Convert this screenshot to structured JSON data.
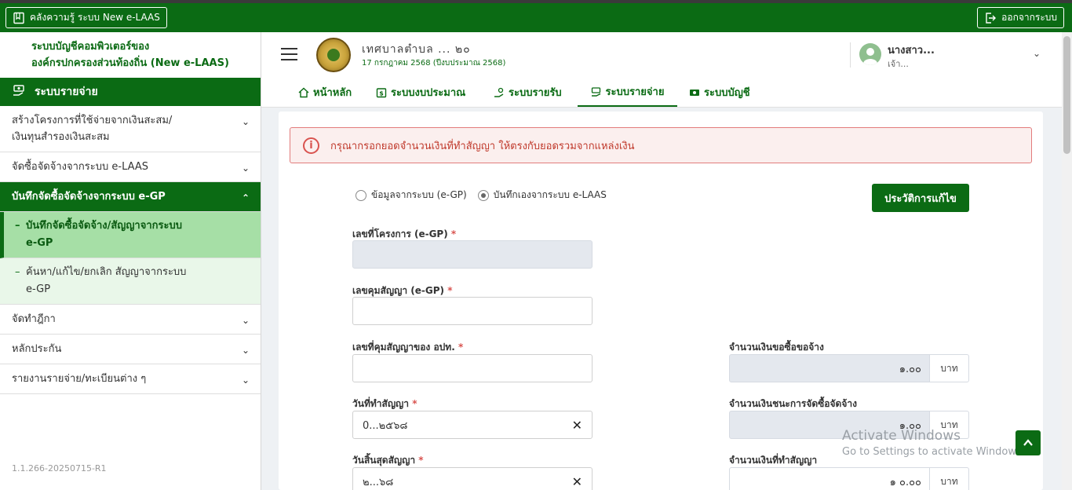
{
  "topbar": {
    "knowledge_label": "คลังความรู้ ระบบ New e-LAAS",
    "logout_label": "ออกจากระบบ"
  },
  "sidebar": {
    "brand_line1": "ระบบบัญชีคอมพิวเตอร์ของ",
    "brand_line2": "องค์กรปกครองส่วนท้องถิ่น (New e-LAAS)",
    "section_title": "ระบบรายจ่าย",
    "items": [
      {
        "label_line1": "สร้างโครงการที่ใช้จ่ายจากเงินสะสม/",
        "label_line2": "เงินทุนสำรองเงินสะสม"
      },
      {
        "label": "จัดซื้อจัดจ้างจากระบบ e-LAAS"
      },
      {
        "label": "บันทึกจัดซื้อจัดจ้างจากระบบ e-GP"
      },
      {
        "label": "จัดทำฎีกา"
      },
      {
        "label": "หลักประกัน"
      },
      {
        "label": "รายงานรายจ่าย/ทะเบียนต่าง ๆ"
      }
    ],
    "subitems": [
      {
        "label_line1": "บันทึกจัดซื้อจัดจ้าง/สัญญาจากระบบ",
        "label_line2": "e-GP"
      },
      {
        "label_line1": "ค้นหา/แก้ไข/ยกเลิก สัญญาจากระบบ",
        "label_line2": "e-GP"
      }
    ],
    "version": "1.1.266-20250715-R1"
  },
  "header": {
    "org_name": "เทศบาลตำบล ... ๒๐",
    "org_date": "17 กรกฎาคม 2568 (ปีงบประมาณ 2568)",
    "user_name": "นางสาว...",
    "user_role": "เจ้า..."
  },
  "tabs": [
    {
      "label": "หน้าหลัก",
      "icon": "home-icon"
    },
    {
      "label": "ระบบงบประมาณ",
      "icon": "budget-icon"
    },
    {
      "label": "ระบบรายรับ",
      "icon": "income-icon"
    },
    {
      "label": "ระบบรายจ่าย",
      "icon": "expense-icon",
      "active": true
    },
    {
      "label": "ระบบบัญชี",
      "icon": "account-icon"
    }
  ],
  "form": {
    "alert": "กรุณากรอกยอดจำนวนเงินที่ทำสัญญา ให้ตรงกับยอดรวมจากแหล่งเงิน",
    "radio_egp": "ข้อมูลจากระบบ (e-GP)",
    "radio_manual": "บันทึกเองจากระบบ e-LAAS",
    "history_button": "ประวัติการแก้ไข",
    "project_no_label": "เลขที่โครงการ (e-GP)",
    "project_no_value": "",
    "contract_ctrl_label": "เลขคุมสัญญา (e-GP)",
    "contract_ctrl_value": "",
    "contract_no_label": "เลขที่คุมสัญญาของ อปท.",
    "contract_no_value": "",
    "contract_date_label": "วันที่ทำสัญญา",
    "contract_date_value": "0...๒๕๖๘",
    "contract_end_label": "วันสิ้นสุดสัญญา",
    "contract_end_value": "๒...๖๘",
    "request_amount_label": "จำนวนเงินขอซื้อขอจ้าง",
    "request_amount_value": "๑.๐๐",
    "winning_amount_label": "จำนวนเงินชนะการจัดซื้อจัดจ้าง",
    "winning_amount_value": "๑.๐๐",
    "contract_amount_label": "จำนวนเงินที่ทำสัญญา",
    "contract_amount_value": "๑ ๐.๐๐",
    "unit": "บาท",
    "required_mark": "*"
  },
  "watermark": {
    "line1": "Activate Windows",
    "line2": "Go to Settings to activate Windows."
  },
  "colors": {
    "brand_green": "#0b6b14",
    "alert_red": "#c0392b",
    "sub_active": "#a6dfa6"
  }
}
